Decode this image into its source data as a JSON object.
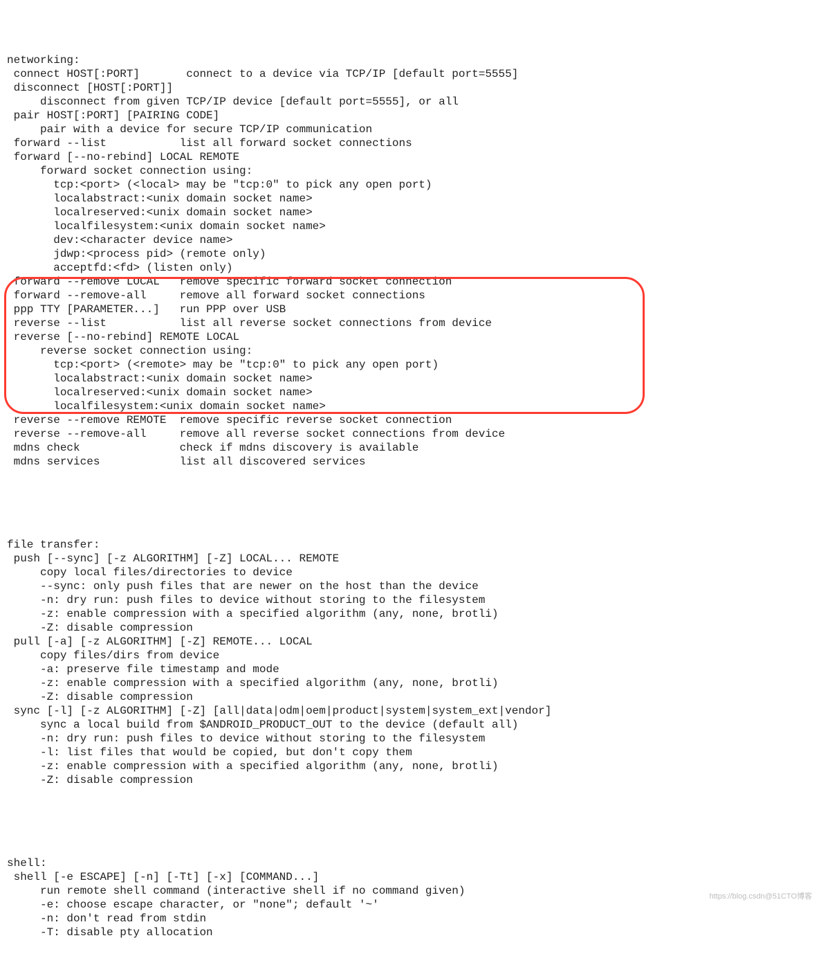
{
  "watermark": "https://blog.csdn@51CTO博客",
  "block_networking": "networking:\n connect HOST[:PORT]       connect to a device via TCP/IP [default port=5555]\n disconnect [HOST[:PORT]]\n     disconnect from given TCP/IP device [default port=5555], or all\n pair HOST[:PORT] [PAIRING CODE]\n     pair with a device for secure TCP/IP communication\n forward --list           list all forward socket connections\n forward [--no-rebind] LOCAL REMOTE\n     forward socket connection using:\n       tcp:<port> (<local> may be \"tcp:0\" to pick any open port)\n       localabstract:<unix domain socket name>\n       localreserved:<unix domain socket name>\n       localfilesystem:<unix domain socket name>\n       dev:<character device name>\n       jdwp:<process pid> (remote only)\n       acceptfd:<fd> (listen only)\n forward --remove LOCAL   remove specific forward socket connection\n forward --remove-all     remove all forward socket connections\n ppp TTY [PARAMETER...]   run PPP over USB\n reverse --list           list all reverse socket connections from device\n reverse [--no-rebind] REMOTE LOCAL\n     reverse socket connection using:\n       tcp:<port> (<remote> may be \"tcp:0\" to pick any open port)\n       localabstract:<unix domain socket name>\n       localreserved:<unix domain socket name>\n       localfilesystem:<unix domain socket name>\n reverse --remove REMOTE  remove specific reverse socket connection\n reverse --remove-all     remove all reverse socket connections from device\n mdns check               check if mdns discovery is available\n mdns services            list all discovered services",
  "block_filetransfer": "file transfer:\n push [--sync] [-z ALGORITHM] [-Z] LOCAL... REMOTE\n     copy local files/directories to device\n     --sync: only push files that are newer on the host than the device\n     -n: dry run: push files to device without storing to the filesystem\n     -z: enable compression with a specified algorithm (any, none, brotli)\n     -Z: disable compression\n pull [-a] [-z ALGORITHM] [-Z] REMOTE... LOCAL\n     copy files/dirs from device\n     -a: preserve file timestamp and mode\n     -z: enable compression with a specified algorithm (any, none, brotli)\n     -Z: disable compression\n sync [-l] [-z ALGORITHM] [-Z] [all|data|odm|oem|product|system|system_ext|vendor]\n     sync a local build from $ANDROID_PRODUCT_OUT to the device (default all)\n     -n: dry run: push files to device without storing to the filesystem\n     -l: list files that would be copied, but don't copy them\n     -z: enable compression with a specified algorithm (any, none, brotli)\n     -Z: disable compression",
  "block_shell": "shell:\n shell [-e ESCAPE] [-n] [-Tt] [-x] [COMMAND...]\n     run remote shell command (interactive shell if no command given)\n     -e: choose escape character, or \"none\"; default '~'\n     -n: don't read from stdin\n     -T: disable pty allocation"
}
